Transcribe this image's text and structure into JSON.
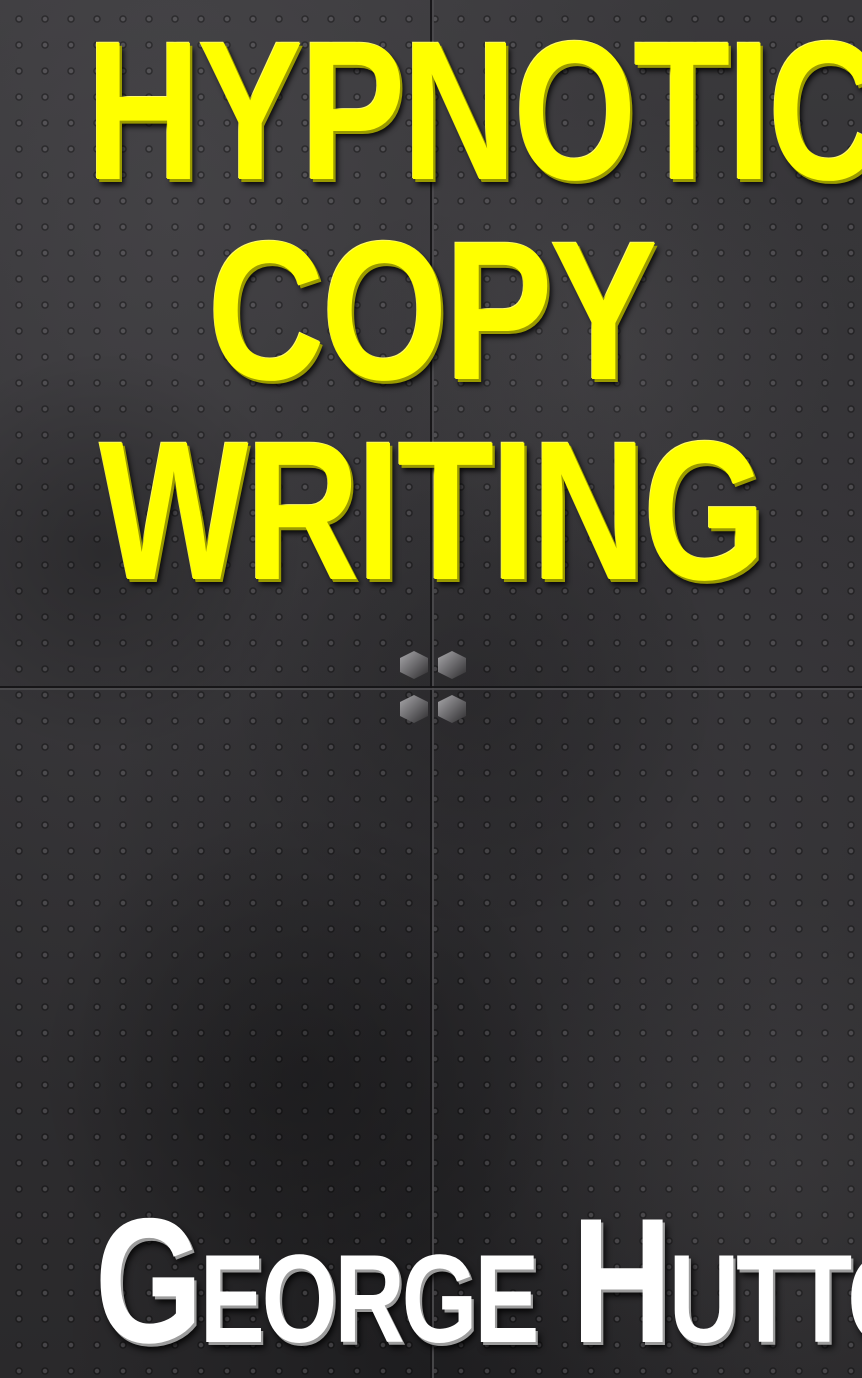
{
  "cover": {
    "title_lines": [
      "HYPNOTIC",
      "COPY",
      "WRITING"
    ],
    "author": "George Hutton"
  },
  "colors": {
    "title": "#ffff00",
    "author": "#ffffff",
    "background": "#323134"
  }
}
